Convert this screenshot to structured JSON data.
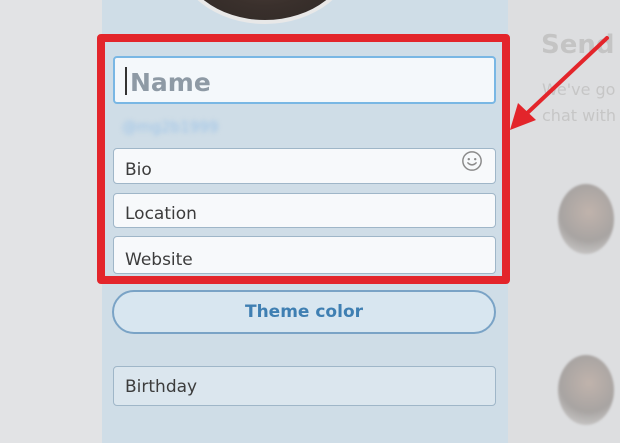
{
  "profile_form": {
    "name_placeholder": "Name",
    "bio_label": "Bio",
    "location_label": "Location",
    "website_label": "Website",
    "theme_button_label": "Theme color",
    "birthday_label": "Birthday",
    "emoji_icon": "smiley-icon"
  },
  "colors": {
    "highlight": "#e3252b",
    "accent": "#3f7fb2"
  },
  "right_panel": {
    "title": "Send y",
    "line1": "We've go",
    "line2": "chat with"
  }
}
